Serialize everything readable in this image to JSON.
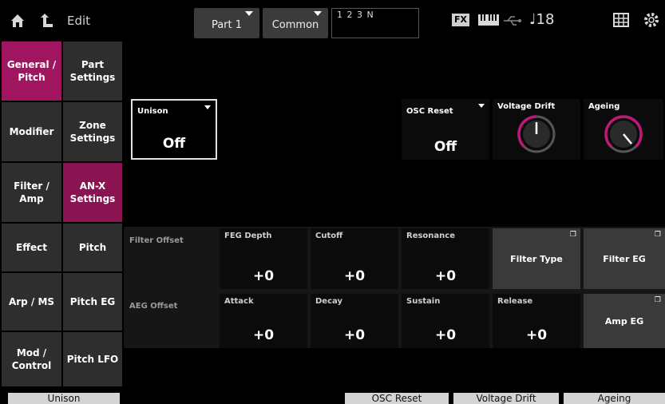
{
  "header": {
    "edit_label": "Edit",
    "part_label": "Part 1",
    "common_label": "Common",
    "performance_number": "1 2 3 N",
    "fx_label": "FX",
    "tempo": "♩18"
  },
  "nav": {
    "col1": [
      "General / Pitch",
      "Modifier",
      "Filter / Amp",
      "Effect",
      "Arp / MS",
      "Mod / Control"
    ],
    "col2": [
      "Part Settings",
      "Zone Settings",
      "AN-X Settings",
      "Pitch",
      "Pitch EG",
      "Pitch LFO"
    ]
  },
  "unison": {
    "label": "Unison",
    "value": "Off"
  },
  "osc_reset": {
    "label": "OSC Reset",
    "value": "Off"
  },
  "voltage_drift": {
    "label": "Voltage Drift",
    "level": 0.5
  },
  "ageing": {
    "label": "Ageing",
    "level": 0.9
  },
  "filter_offset": {
    "label": "Filter Offset",
    "params": [
      {
        "name": "FEG Depth",
        "value": "+0"
      },
      {
        "name": "Cutoff",
        "value": "+0"
      },
      {
        "name": "Resonance",
        "value": "+0"
      }
    ],
    "filter_type_label": "Filter Type",
    "filter_eg_label": "Filter EG"
  },
  "aeg_offset": {
    "label": "AEG Offset",
    "params": [
      {
        "name": "Attack",
        "value": "+0"
      },
      {
        "name": "Decay",
        "value": "+0"
      },
      {
        "name": "Sustain",
        "value": "+0"
      },
      {
        "name": "Release",
        "value": "+0"
      }
    ],
    "amp_eg_label": "Amp EG"
  },
  "bottom": {
    "unison": "Unison",
    "osc_reset": "OSC Reset",
    "voltage_drift": "Voltage Drift",
    "ageing": "Ageing"
  },
  "colors": {
    "accent": "#a0155f",
    "knob_ring": "#c0187a"
  }
}
